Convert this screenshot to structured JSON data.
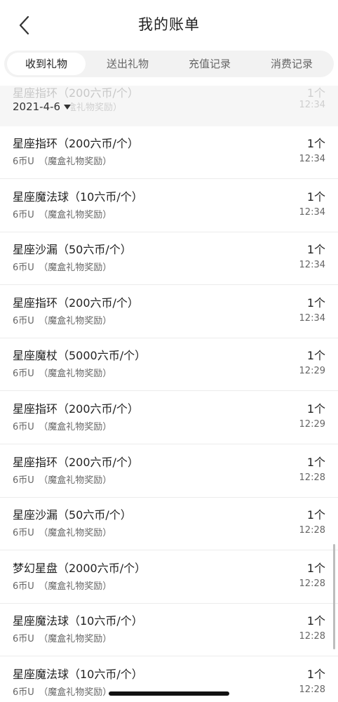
{
  "header": {
    "title": "我的账单"
  },
  "tabs": [
    {
      "label": "收到礼物",
      "active": true
    },
    {
      "label": "送出礼物",
      "active": false
    },
    {
      "label": "充值记录",
      "active": false
    },
    {
      "label": "消费记录",
      "active": false
    }
  ],
  "sticky": {
    "date": "2021-4-6",
    "ghost_name": "星座指环（200六币/个）",
    "ghost_sub": "盒礼物奖励）",
    "ghost_qty": "1个",
    "ghost_time": "12:34"
  },
  "records": [
    {
      "name": "星座指环（200六币/个）",
      "sub": "6币U　（魔盒礼物奖励）",
      "qty": "1个",
      "time": "12:34"
    },
    {
      "name": "星座魔法球（10六币/个）",
      "sub": "6币U　（魔盒礼物奖励）",
      "qty": "1个",
      "time": "12:34"
    },
    {
      "name": "星座沙漏（50六币/个）",
      "sub": "6币U　（魔盒礼物奖励）",
      "qty": "1个",
      "time": "12:34"
    },
    {
      "name": "星座指环（200六币/个）",
      "sub": "6币U　（魔盒礼物奖励）",
      "qty": "1个",
      "time": "12:34"
    },
    {
      "name": "星座魔杖（5000六币/个）",
      "sub": "6币U　（魔盒礼物奖励）",
      "qty": "1个",
      "time": "12:29"
    },
    {
      "name": "星座指环（200六币/个）",
      "sub": "6币U　（魔盒礼物奖励）",
      "qty": "1个",
      "time": "12:29"
    },
    {
      "name": "星座指环（200六币/个）",
      "sub": "6币U　（魔盒礼物奖励）",
      "qty": "1个",
      "time": "12:28"
    },
    {
      "name": "星座沙漏（50六币/个）",
      "sub": "6币U　（魔盒礼物奖励）",
      "qty": "1个",
      "time": "12:28"
    },
    {
      "name": "梦幻星盘（2000六币/个）",
      "sub": "6币U　（魔盒礼物奖励）",
      "qty": "1个",
      "time": "12:28"
    },
    {
      "name": "星座魔法球（10六币/个）",
      "sub": "6币U　（魔盒礼物奖励）",
      "qty": "1个",
      "time": "12:28"
    },
    {
      "name": "星座魔法球（10六币/个）",
      "sub": "6币U　（魔盒礼物奖励）",
      "qty": "1个",
      "time": "12:28"
    }
  ]
}
